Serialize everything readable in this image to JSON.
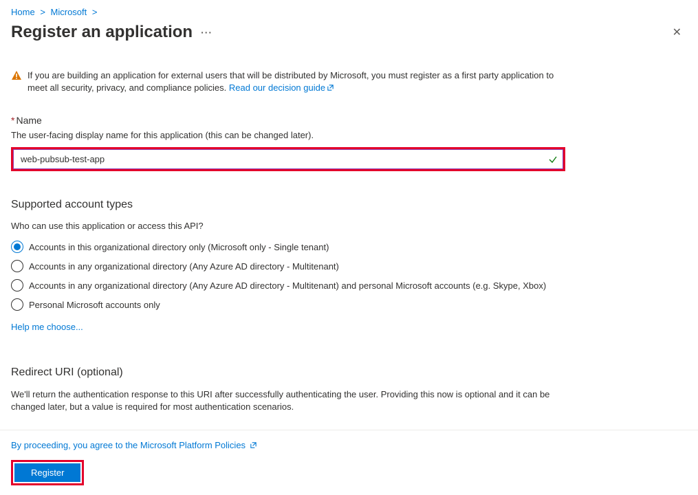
{
  "breadcrumb": {
    "home": "Home",
    "tenant": "Microsoft"
  },
  "page_title": "Register an application",
  "warning": {
    "text_before": "If you are building an application for external users that will be distributed by Microsoft, you must register as a first party application to meet all security, privacy, and compliance policies. ",
    "link_text": "Read our decision guide"
  },
  "name_section": {
    "label": "Name",
    "hint": "The user-facing display name for this application (this can be changed later).",
    "value": "web-pubsub-test-app"
  },
  "account_types": {
    "heading": "Supported account types",
    "subtext": "Who can use this application or access this API?",
    "options": [
      "Accounts in this organizational directory only (Microsoft only - Single tenant)",
      "Accounts in any organizational directory (Any Azure AD directory - Multitenant)",
      "Accounts in any organizational directory (Any Azure AD directory - Multitenant) and personal Microsoft accounts (e.g. Skype, Xbox)",
      "Personal Microsoft accounts only"
    ],
    "help_link": "Help me choose..."
  },
  "redirect_uri": {
    "heading": "Redirect URI (optional)",
    "description": "We'll return the authentication response to this URI after successfully authenticating the user. Providing this now is optional and it can be changed later, but a value is required for most authentication scenarios."
  },
  "footer": {
    "consent": "By proceeding, you agree to the Microsoft Platform Policies",
    "register_label": "Register"
  }
}
